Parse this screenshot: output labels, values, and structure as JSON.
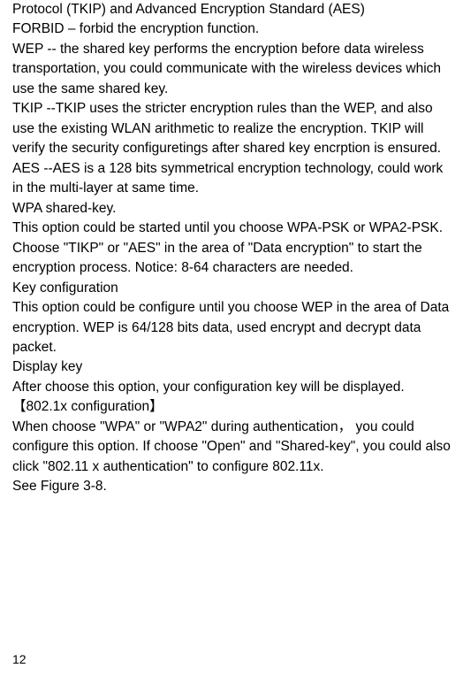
{
  "paragraphs": {
    "p1": "Protocol (TKIP) and Advanced Encryption Standard (AES)",
    "p2": "FORBID – forbid the encryption function.",
    "p3": "WEP -- the shared key performs the encryption before data wireless transportation, you could communicate with the wireless devices which use the same shared key.",
    "p4": "TKIP --TKIP uses the stricter encryption rules than the WEP, and also use the existing WLAN arithmetic to realize the encryption. TKIP will verify the security configuretings after shared key encrption is ensured.",
    "p5": "AES --AES is a 128 bits symmetrical encryption technology, could work in the multi-layer at same time.",
    "p6": "WPA shared-key.",
    "p7": "This option could be started until you choose WPA-PSK or WPA2-PSK. Choose \"TIKP\" or \"AES\" in the area of \"Data encryption\" to start the encryption process. Notice: 8-64 characters are needed.",
    "p8": "Key configuration",
    "p9": "This option could be configure until you choose WEP in the area of Data encryption. WEP is 64/128 bits data, used encrypt and decrypt data packet.",
    "p10": "Display key",
    "p11": "After choose this option, your configuration key will be displayed.",
    "p12": "【802.1x configuration】",
    "p13": "When choose \"WPA\" or \"WPA2\" during authentication，  you could configure this option. If choose \"Open\" and \"Shared-key\", you could also click \"802.11 x authentication\" to configure 802.11x.",
    "p14": "See Figure 3-8."
  },
  "page_number": "12"
}
